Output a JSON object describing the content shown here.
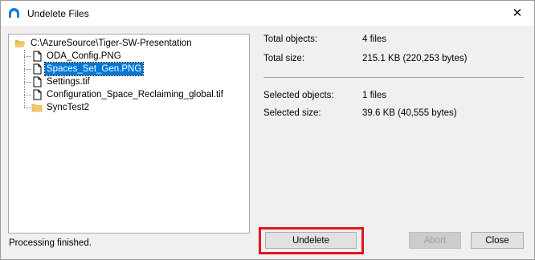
{
  "window": {
    "title": "Undelete Files",
    "close_glyph": "✕",
    "icon": "app-icon"
  },
  "tree": {
    "root": {
      "label": "C:\\AzureSource\\Tiger-SW-Presentation",
      "icon": "folder-open-icon"
    },
    "items": [
      {
        "label": "ODA_Config.PNG",
        "icon": "file-icon",
        "selected": false
      },
      {
        "label": "Spaces_Set_Gen.PNG",
        "icon": "file-icon",
        "selected": true
      },
      {
        "label": "Settings.tif",
        "icon": "file-icon",
        "selected": false
      },
      {
        "label": "Configuration_Space_Reclaiming_global.tif",
        "icon": "file-icon",
        "selected": false
      },
      {
        "label": "SyncTest2",
        "icon": "folder-icon",
        "selected": false
      }
    ]
  },
  "info": {
    "total_objects_label": "Total objects:",
    "total_objects_value": "4 files",
    "total_size_label": "Total size:",
    "total_size_value": "215.1 KB (220,253 bytes)",
    "selected_objects_label": "Selected objects:",
    "selected_objects_value": "1 files",
    "selected_size_label": "Selected size:",
    "selected_size_value": "39.6 KB (40,555 bytes)"
  },
  "status": {
    "text": "Processing finished."
  },
  "buttons": {
    "undelete": "Undelete",
    "abort": "Abort",
    "close": "Close"
  },
  "colors": {
    "selection": "#0078d7",
    "highlight_border": "#e0161d",
    "folder": "#f5c96b",
    "app_icon": "#1a7fd4"
  }
}
